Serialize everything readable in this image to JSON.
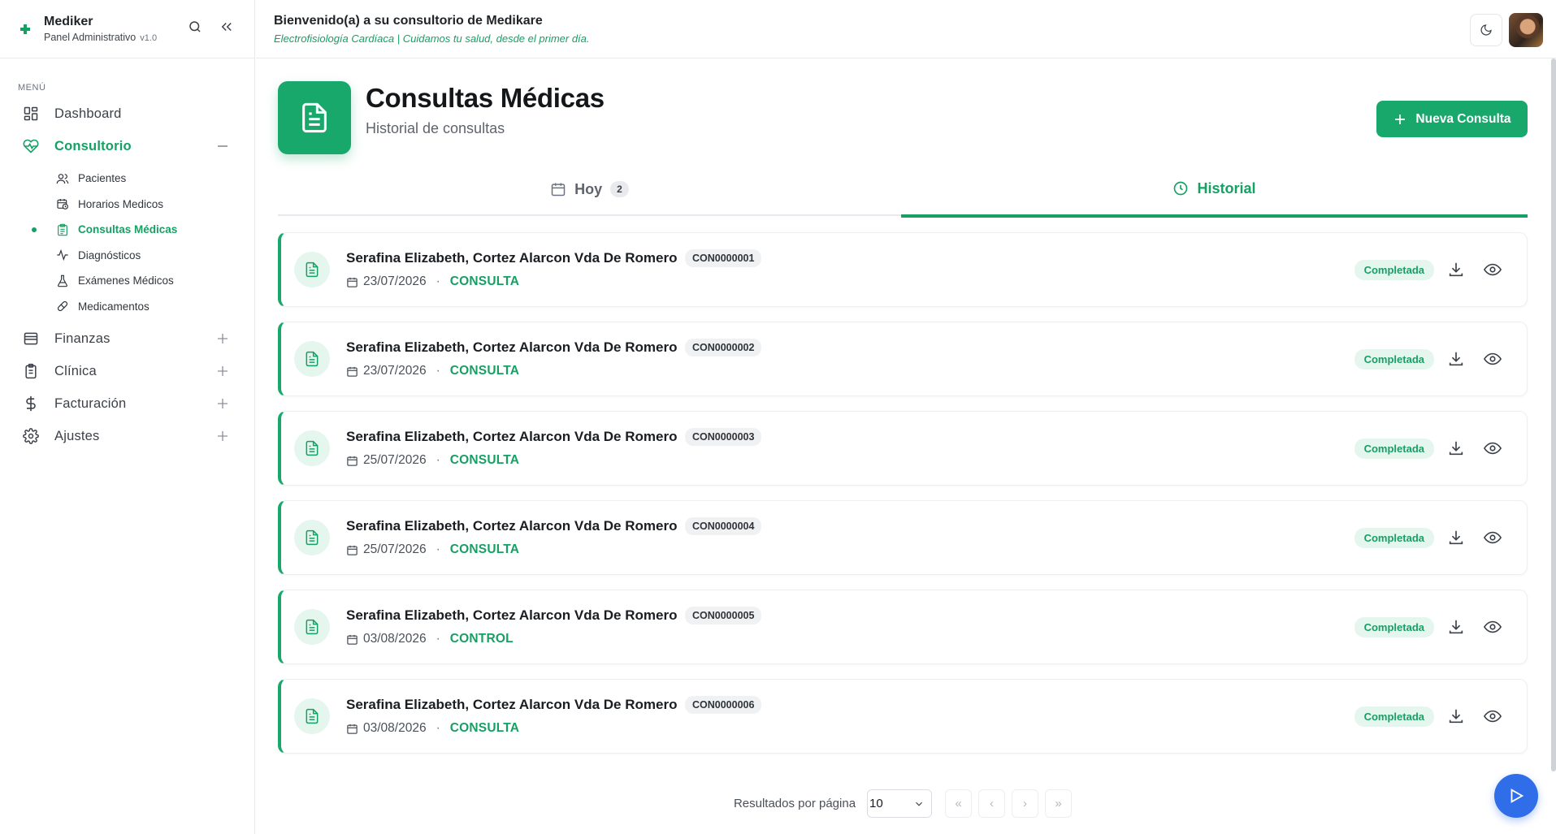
{
  "brand": {
    "name": "Mediker",
    "subtitle": "Panel Administrativo",
    "version": "v1.0"
  },
  "header": {
    "welcome": "Bienvenido(a) a su consultorio de Medikare",
    "tagline": "Electrofisiología Cardíaca | Cuidamos tu salud, desde el primer día."
  },
  "sidebar": {
    "caption": "MENÚ",
    "items": [
      {
        "label": "Dashboard",
        "icon": "grid-icon"
      },
      {
        "label": "Consultorio",
        "icon": "heart-pulse-icon",
        "active": true,
        "expanded": true
      },
      {
        "label": "Finanzas",
        "icon": "wallet-icon"
      },
      {
        "label": "Clínica",
        "icon": "clipboard-icon"
      },
      {
        "label": "Facturación",
        "icon": "dollar-icon"
      },
      {
        "label": "Ajustes",
        "icon": "gear-icon"
      }
    ],
    "sub_items": [
      {
        "label": "Pacientes",
        "icon": "users-icon"
      },
      {
        "label": "Horarios Medicos",
        "icon": "calendar-clock-icon"
      },
      {
        "label": "Consultas Médicas",
        "icon": "clipboard-list-icon",
        "active": true
      },
      {
        "label": "Diagnósticos",
        "icon": "activity-icon"
      },
      {
        "label": "Exámenes Médicos",
        "icon": "flask-icon"
      },
      {
        "label": "Medicamentos",
        "icon": "pill-icon"
      }
    ]
  },
  "page": {
    "title": "Consultas Médicas",
    "subtitle": "Historial de consultas",
    "new_button": "Nueva Consulta"
  },
  "tabs": [
    {
      "label": "Hoy",
      "badge": "2",
      "icon": "calendar-icon"
    },
    {
      "label": "Historial",
      "icon": "clock-icon",
      "active": true
    }
  ],
  "consultas": [
    {
      "patient": "Serafina Elizabeth, Cortez Alarcon Vda De Romero",
      "code": "CON0000001",
      "date": "23/07/2026",
      "type": "CONSULTA",
      "status": "Completada"
    },
    {
      "patient": "Serafina Elizabeth, Cortez Alarcon Vda De Romero",
      "code": "CON0000002",
      "date": "23/07/2026",
      "type": "CONSULTA",
      "status": "Completada"
    },
    {
      "patient": "Serafina Elizabeth, Cortez Alarcon Vda De Romero",
      "code": "CON0000003",
      "date": "25/07/2026",
      "type": "CONSULTA",
      "status": "Completada"
    },
    {
      "patient": "Serafina Elizabeth, Cortez Alarcon Vda De Romero",
      "code": "CON0000004",
      "date": "25/07/2026",
      "type": "CONSULTA",
      "status": "Completada"
    },
    {
      "patient": "Serafina Elizabeth, Cortez Alarcon Vda De Romero",
      "code": "CON0000005",
      "date": "03/08/2026",
      "type": "CONTROL",
      "status": "Completada"
    },
    {
      "patient": "Serafina Elizabeth, Cortez Alarcon Vda De Romero",
      "code": "CON0000006",
      "date": "03/08/2026",
      "type": "CONSULTA",
      "status": "Completada"
    }
  ],
  "pagination": {
    "label": "Resultados por página",
    "page_size": "10",
    "first": "«",
    "prev": "‹",
    "next": "›",
    "last": "»"
  },
  "colors": {
    "accent": "#19a86b",
    "fab": "#2f6ee8"
  }
}
